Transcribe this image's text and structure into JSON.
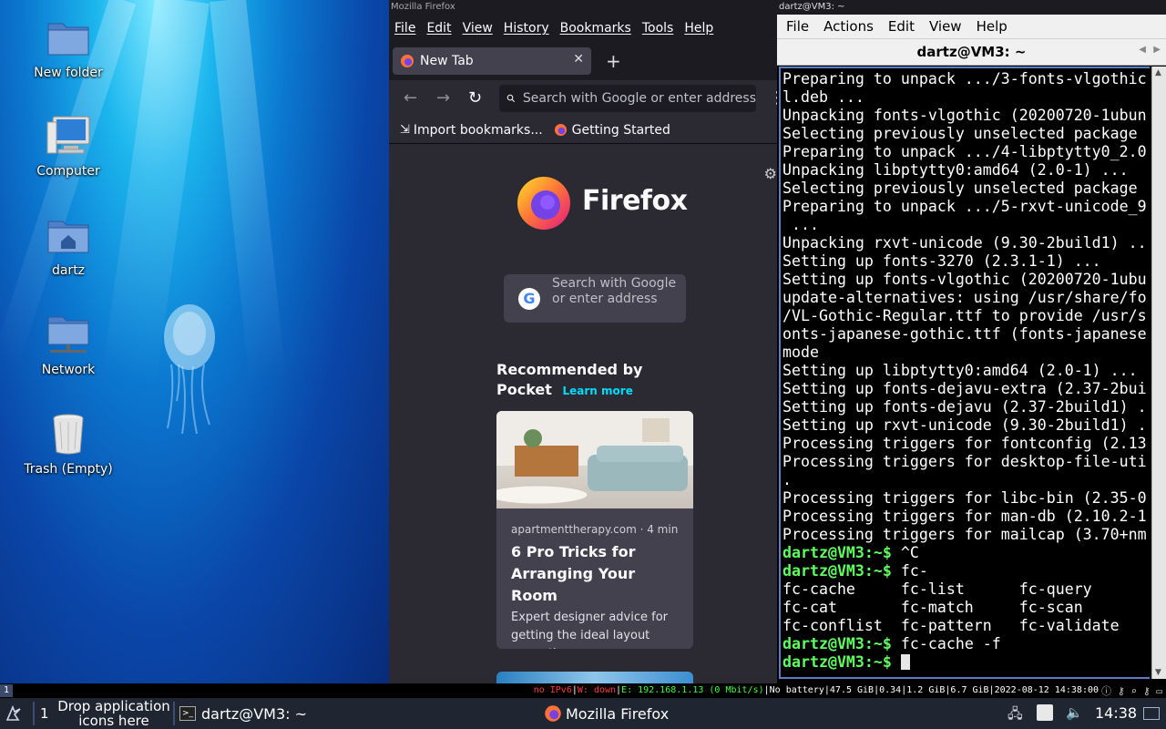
{
  "desktop": {
    "icons": [
      {
        "label": "New folder"
      },
      {
        "label": "Computer"
      },
      {
        "label": "dartz"
      },
      {
        "label": "Network"
      },
      {
        "label": "Trash (Empty)"
      }
    ]
  },
  "firefox": {
    "window_title": "Mozilla Firefox",
    "menu": [
      "File",
      "Edit",
      "View",
      "History",
      "Bookmarks",
      "Tools",
      "Help"
    ],
    "tab_title": "New Tab",
    "url_placeholder": "Search with Google or enter address",
    "bookmarks": [
      "Import bookmarks...",
      "Getting Started"
    ],
    "wordmark": "Firefox",
    "search_placeholder": "Search with Google or enter address",
    "pocket_heading": "Recommended by Pocket",
    "learn_more": "Learn more",
    "card": {
      "meta": "apartmenttherapy.com · 4 min",
      "title": "6 Pro Tricks for Arranging Your Room",
      "description": "Expert designer advice for getting the ideal layout every time."
    }
  },
  "terminal": {
    "window_title": "dartz@VM3: ~",
    "menu": [
      "File",
      "Actions",
      "Edit",
      "View",
      "Help"
    ],
    "tab_title": "dartz@VM3: ~",
    "output_lines": [
      "Preparing to unpack .../3-fonts-vlgothic",
      "l.deb ...",
      "Unpacking fonts-vlgothic (20200720-1ubun",
      "Selecting previously unselected package",
      "Preparing to unpack .../4-libptytty0_2.0",
      "Unpacking libptytty0:amd64 (2.0-1) ...",
      "Selecting previously unselected package",
      "Preparing to unpack .../5-rxvt-unicode_9",
      " ...",
      "Unpacking rxvt-unicode (9.30-2build1) ..",
      "Setting up fonts-3270 (2.3.1-1) ...",
      "Setting up fonts-vlgothic (20200720-1ubu",
      "update-alternatives: using /usr/share/fo",
      "/VL-Gothic-Regular.ttf to provide /usr/s",
      "onts-japanese-gothic.ttf (fonts-japanese",
      "mode",
      "Setting up libptytty0:amd64 (2.0-1) ...",
      "Setting up fonts-dejavu-extra (2.37-2bui",
      "Setting up fonts-dejavu (2.37-2build1) .",
      "Setting up rxvt-unicode (9.30-2build1) .",
      "Processing triggers for fontconfig (2.13",
      "Processing triggers for desktop-file-uti",
      ".",
      "Processing triggers for libc-bin (2.35-0",
      "Processing triggers for man-db (2.10.2-1",
      "Processing triggers for mailcap (3.70+nm"
    ],
    "prompt": "dartz@VM3:~$",
    "commands": [
      " ^C",
      " fc-"
    ],
    "completions": [
      "fc-cache     fc-list      fc-query",
      "fc-cat       fc-match     fc-scan",
      "fc-conflist  fc-pattern   fc-validate"
    ],
    "command3": " fc-cache -f",
    "command4": " "
  },
  "statusbar": {
    "workspace": "1",
    "ipv6": "no IPv6",
    "wifi": "W: down",
    "ethernet": "E: 192.168.1.13 (0 Mbit/s)",
    "battery": "No battery",
    "disk": "47.5 GiB",
    "load": "0.34",
    "mem": "1.2 GiB",
    "swap": "6.7 GiB",
    "datetime": "2022-08-12 14:38:00"
  },
  "panel": {
    "workspace": "1",
    "drop_label": "Drop application icons here",
    "tasks": [
      "dartz@VM3: ~",
      "Mozilla Firefox"
    ],
    "clock": "14:38"
  },
  "colors": {
    "prompt": "#5fff5f",
    "firefox_bg": "#2b2a33",
    "panel_bg": "#1f2531",
    "status_red": "#ff3b3b",
    "status_green": "#3bff3b"
  }
}
